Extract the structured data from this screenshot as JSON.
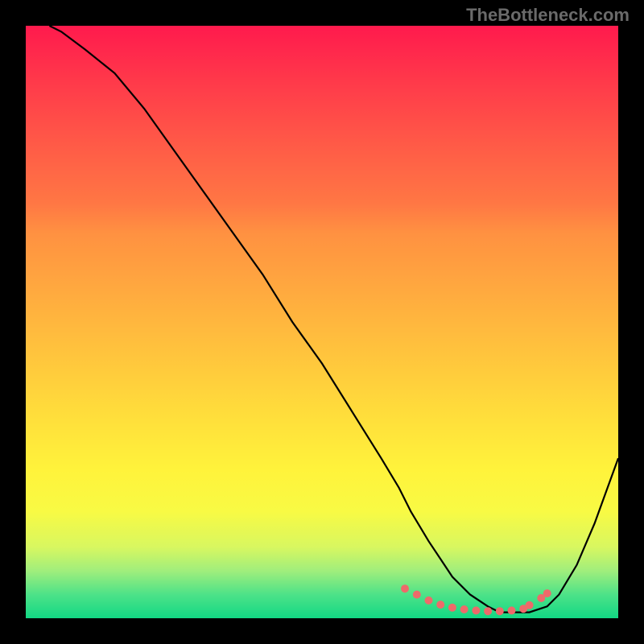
{
  "watermark": "TheBottleneck.com",
  "chart_data": {
    "type": "line",
    "title": "",
    "xlabel": "",
    "ylabel": "",
    "xlim": [
      0,
      100
    ],
    "ylim": [
      0,
      100
    ],
    "series": [
      {
        "name": "curve",
        "color": "#000000",
        "x": [
          4,
          6,
          10,
          15,
          20,
          25,
          30,
          35,
          40,
          45,
          50,
          55,
          60,
          63,
          65,
          68,
          70,
          72,
          75,
          78,
          80,
          82,
          85,
          88,
          90,
          93,
          96,
          100
        ],
        "y": [
          100,
          99,
          96,
          92,
          86,
          79,
          72,
          65,
          58,
          50,
          43,
          35,
          27,
          22,
          18,
          13,
          10,
          7,
          4,
          2,
          1,
          1,
          1,
          2,
          4,
          9,
          16,
          27
        ]
      },
      {
        "name": "dots",
        "color": "#ee6a6a",
        "type": "scatter",
        "x": [
          64,
          66,
          68,
          70,
          72,
          74,
          76,
          78,
          80,
          82,
          84,
          85,
          87,
          88
        ],
        "y": [
          5,
          4,
          3,
          2.3,
          1.8,
          1.5,
          1.3,
          1.2,
          1.2,
          1.3,
          1.6,
          2.2,
          3.4,
          4.2
        ]
      }
    ]
  }
}
